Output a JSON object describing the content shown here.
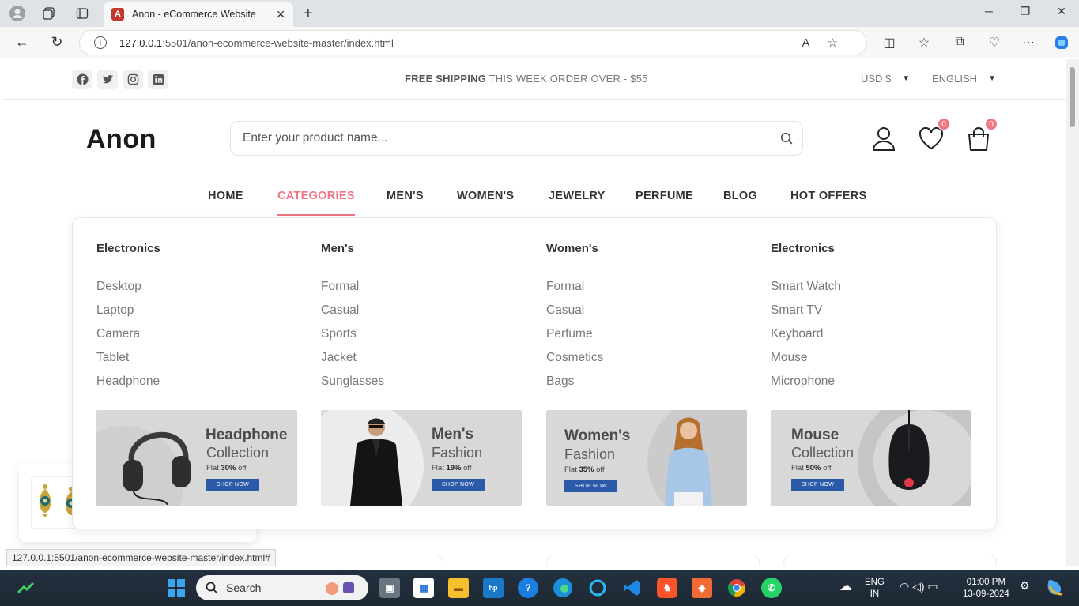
{
  "browser": {
    "tab_title": "Anon - eCommerce Website",
    "url_host": "127.0.0.1",
    "url_rest": ":5501/anon-ecommerce-website-master/index.html"
  },
  "topbar": {
    "shipping_bold": "FREE SHIPPING",
    "shipping_text": "THIS WEEK ORDER OVER - $55",
    "currency": "USD $",
    "language": "ENGLISH"
  },
  "header": {
    "logo": "Anon",
    "search_placeholder": "Enter your product name...",
    "wishlist_count": "0",
    "cart_count": "0"
  },
  "nav": [
    "HOME",
    "CATEGORIES",
    "MEN'S",
    "WOMEN'S",
    "JEWELRY",
    "PERFUME",
    "BLOG",
    "HOT OFFERS"
  ],
  "dropdown": {
    "columns": [
      {
        "title": "Electronics",
        "items": [
          "Desktop",
          "Laptop",
          "Camera",
          "Tablet",
          "Headphone"
        ]
      },
      {
        "title": "Men's",
        "items": [
          "Formal",
          "Casual",
          "Sports",
          "Jacket",
          "Sunglasses"
        ]
      },
      {
        "title": "Women's",
        "items": [
          "Formal",
          "Casual",
          "Perfume",
          "Cosmetics",
          "Bags"
        ]
      },
      {
        "title": "Electronics",
        "items": [
          "Smart Watch",
          "Smart TV",
          "Keyboard",
          "Mouse",
          "Microphone"
        ]
      }
    ],
    "banners": [
      {
        "title": "Headphone",
        "sub": "Collection",
        "flat_pre": "Flat ",
        "flat_pct": "30%",
        "flat_post": " off",
        "btn": "SHOP NOW"
      },
      {
        "title": "Men's",
        "sub": "Fashion",
        "flat_pre": "Flat ",
        "flat_pct": "19%",
        "flat_post": " off",
        "btn": "SHOP NOW"
      },
      {
        "title": "Women's",
        "sub": "Fashion",
        "flat_pre": "Flat ",
        "flat_pct": "35%",
        "flat_post": " off",
        "btn": "SHOP NOW"
      },
      {
        "title": "Mouse",
        "sub": "Collection",
        "flat_pre": "Flat ",
        "flat_pct": "50%",
        "flat_post": " off",
        "btn": "SHOP NOW"
      }
    ]
  },
  "status_url": "127.0.0.1:5501/anon-ecommerce-website-master/index.html#",
  "taskbar": {
    "search": "Search",
    "lang_line1": "ENG",
    "lang_line2": "IN",
    "time": "01:00 PM",
    "date": "13-09-2024"
  },
  "colors": {
    "accent": "#f27584",
    "banner_button": "#2a5aa8"
  }
}
